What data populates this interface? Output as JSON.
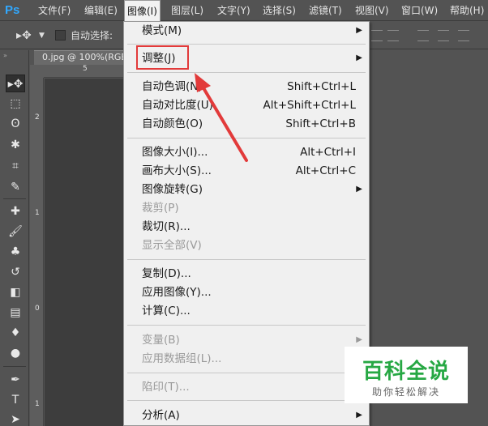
{
  "app": {
    "logo": "Ps"
  },
  "menubar": {
    "items": [
      {
        "label": "文件(F)"
      },
      {
        "label": "编辑(E)"
      },
      {
        "label": "图像(I)"
      },
      {
        "label": "图层(L)"
      },
      {
        "label": "文字(Y)"
      },
      {
        "label": "选择(S)"
      },
      {
        "label": "滤镜(T)"
      },
      {
        "label": "视图(V)"
      },
      {
        "label": "窗口(W)"
      },
      {
        "label": "帮助(H)"
      }
    ]
  },
  "options_bar": {
    "auto_select_label": "自动选择:"
  },
  "document": {
    "tab_label": "0.jpg @ 100%(RGB"
  },
  "rulers": {
    "h_tick": "5",
    "v_ticks": [
      "2",
      "1",
      "0",
      "1"
    ]
  },
  "image_menu": {
    "items": [
      {
        "label": "模式(M)",
        "shortcut": "",
        "submenu": true,
        "disabled": false
      },
      {
        "label": "调整(J)",
        "shortcut": "",
        "submenu": true,
        "disabled": false
      },
      {
        "label": "自动色调(N)",
        "shortcut": "Shift+Ctrl+L",
        "submenu": false,
        "disabled": false
      },
      {
        "label": "自动对比度(U)",
        "shortcut": "Alt+Shift+Ctrl+L",
        "submenu": false,
        "disabled": false
      },
      {
        "label": "自动颜色(O)",
        "shortcut": "Shift+Ctrl+B",
        "submenu": false,
        "disabled": false
      },
      {
        "label": "图像大小(I)...",
        "shortcut": "Alt+Ctrl+I",
        "submenu": false,
        "disabled": false
      },
      {
        "label": "画布大小(S)...",
        "shortcut": "Alt+Ctrl+C",
        "submenu": false,
        "disabled": false
      },
      {
        "label": "图像旋转(G)",
        "shortcut": "",
        "submenu": true,
        "disabled": false
      },
      {
        "label": "裁剪(P)",
        "shortcut": "",
        "submenu": false,
        "disabled": true
      },
      {
        "label": "裁切(R)...",
        "shortcut": "",
        "submenu": false,
        "disabled": false
      },
      {
        "label": "显示全部(V)",
        "shortcut": "",
        "submenu": false,
        "disabled": true
      },
      {
        "label": "复制(D)...",
        "shortcut": "",
        "submenu": false,
        "disabled": false
      },
      {
        "label": "应用图像(Y)...",
        "shortcut": "",
        "submenu": false,
        "disabled": false
      },
      {
        "label": "计算(C)...",
        "shortcut": "",
        "submenu": false,
        "disabled": false
      },
      {
        "label": "变量(B)",
        "shortcut": "",
        "submenu": true,
        "disabled": true
      },
      {
        "label": "应用数据组(L)...",
        "shortcut": "",
        "submenu": false,
        "disabled": true
      },
      {
        "label": "陷印(T)...",
        "shortcut": "",
        "submenu": false,
        "disabled": true
      },
      {
        "label": "分析(A)",
        "shortcut": "",
        "submenu": true,
        "disabled": false
      }
    ]
  },
  "annotation": {
    "color": "#e23a3a"
  },
  "watermark": {
    "title": "百科全说",
    "subtitle": "助你轻松解决"
  },
  "colors": {
    "ps_blue": "#31a8ff",
    "watermark_green": "#27a844"
  },
  "icons": {
    "toolbox": [
      "move-icon",
      "marquee-icon",
      "lasso-icon",
      "magic-wand-icon",
      "crop-icon",
      "eyedropper-icon",
      "healing-brush-icon",
      "brush-icon",
      "clone-stamp-icon",
      "history-brush-icon",
      "eraser-icon",
      "gradient-icon",
      "blur-icon",
      "dodge-icon",
      "pen-icon",
      "type-icon",
      "path-selection-icon"
    ]
  }
}
